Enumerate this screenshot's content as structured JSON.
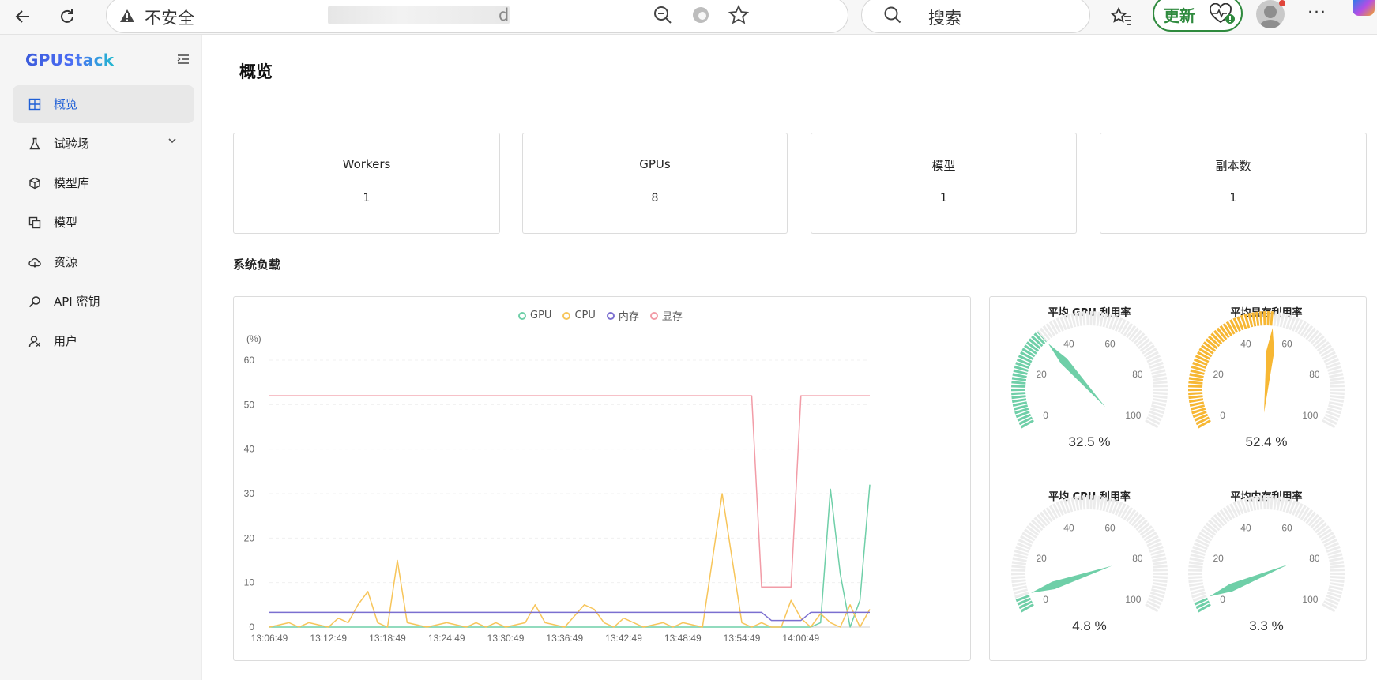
{
  "browser": {
    "insecure_label": "不安全",
    "url_tail": "d",
    "search_placeholder": "搜索",
    "update_label": "更新",
    "more_label": "···"
  },
  "sidebar": {
    "logo": "GPUStack",
    "items": [
      {
        "label": "概览",
        "icon": "dashboard-icon",
        "active": true
      },
      {
        "label": "试验场",
        "icon": "flask-icon",
        "expandable": true
      },
      {
        "label": "模型库",
        "icon": "cube-icon"
      },
      {
        "label": "模型",
        "icon": "copy-icon"
      },
      {
        "label": "资源",
        "icon": "cloud-icon"
      },
      {
        "label": "API 密钥",
        "icon": "key-icon"
      },
      {
        "label": "用户",
        "icon": "user-icon"
      }
    ]
  },
  "page": {
    "title": "概览",
    "stats": [
      {
        "label": "Workers",
        "value": "1"
      },
      {
        "label": "GPUs",
        "value": "8"
      },
      {
        "label": "模型",
        "value": "1"
      },
      {
        "label": "副本数",
        "value": "1"
      }
    ],
    "section_title": "系统负载"
  },
  "chart_data": [
    {
      "type": "line",
      "ylabel": "(%)",
      "ylim": [
        0,
        60
      ],
      "yticks": [
        0,
        10,
        20,
        30,
        40,
        50,
        60
      ],
      "categories": [
        "13:06:49",
        "13:12:49",
        "13:18:49",
        "13:24:49",
        "13:30:49",
        "13:36:49",
        "13:42:49",
        "13:48:49",
        "13:54:49",
        "14:00:49"
      ],
      "legend_position": "top-center",
      "grid": true,
      "series": [
        {
          "name": "GPU",
          "color": "#6fcfa8",
          "x": [
            0,
            2,
            4,
            6,
            8,
            10,
            12,
            14,
            16,
            18,
            20,
            22,
            24,
            26,
            28,
            30,
            32,
            34,
            36,
            38,
            40,
            42,
            44,
            46,
            48,
            50,
            52,
            54,
            55,
            56,
            57,
            58,
            59,
            60,
            61
          ],
          "y": [
            0,
            0,
            0,
            0,
            0,
            0,
            0,
            0,
            0,
            0,
            0,
            0,
            0,
            0,
            0,
            0,
            0,
            0,
            0,
            0,
            0,
            0,
            0,
            0,
            0,
            0,
            0,
            0,
            0,
            1,
            31,
            12,
            0,
            6,
            32
          ]
        },
        {
          "name": "CPU",
          "color": "#f7c55a",
          "x": [
            0,
            2,
            3,
            4,
            6,
            7,
            8,
            9,
            10,
            11,
            12,
            13,
            14,
            16,
            18,
            20,
            21,
            22,
            23,
            24,
            26,
            27,
            28,
            30,
            32,
            33,
            34,
            35,
            36,
            38,
            40,
            41,
            42,
            44,
            46,
            48,
            49,
            50,
            51,
            52,
            53,
            54,
            55,
            56,
            57,
            58,
            59,
            60,
            61
          ],
          "y": [
            0,
            1,
            0,
            1,
            0,
            2,
            1,
            5,
            8,
            1,
            0,
            15,
            1,
            0,
            1,
            0,
            1,
            0,
            1,
            0,
            1,
            5,
            1,
            0,
            5,
            4,
            1,
            0,
            2,
            0,
            1,
            0,
            1,
            0,
            30,
            1,
            0,
            1,
            0,
            0,
            6,
            2,
            0,
            3,
            1,
            0,
            5,
            0,
            4
          ]
        },
        {
          "name": "内存",
          "color": "#7b6fd0",
          "x": [
            0,
            50,
            51,
            54,
            55,
            56,
            57,
            58,
            59,
            60,
            61
          ],
          "y": [
            3.3,
            3.3,
            1.5,
            1.5,
            3.3,
            3.3,
            3.3,
            3.3,
            3.3,
            3.3,
            3.3
          ]
        },
        {
          "name": "显存",
          "color": "#f29ca7",
          "x": [
            0,
            49,
            50,
            53,
            54,
            61
          ],
          "y": [
            52,
            52,
            9,
            9,
            52,
            52
          ]
        }
      ]
    },
    {
      "type": "gauge",
      "gauges": [
        {
          "title": "平均 GPU 利用率",
          "value": 32.5,
          "display": "32.5 %",
          "color": "#6fcfa8"
        },
        {
          "title": "平均显存利用率",
          "value": 52.4,
          "display": "52.4 %",
          "color": "#f7b733"
        },
        {
          "title": "平均 CPU 利用率",
          "value": 4.8,
          "display": "4.8 %",
          "color": "#6fcfa8"
        },
        {
          "title": "平均内存利用率",
          "value": 3.3,
          "display": "3.3 %",
          "color": "#6fcfa8"
        }
      ],
      "ticks": [
        0,
        20,
        40,
        60,
        80,
        100
      ],
      "track_color": "#ececec"
    }
  ]
}
